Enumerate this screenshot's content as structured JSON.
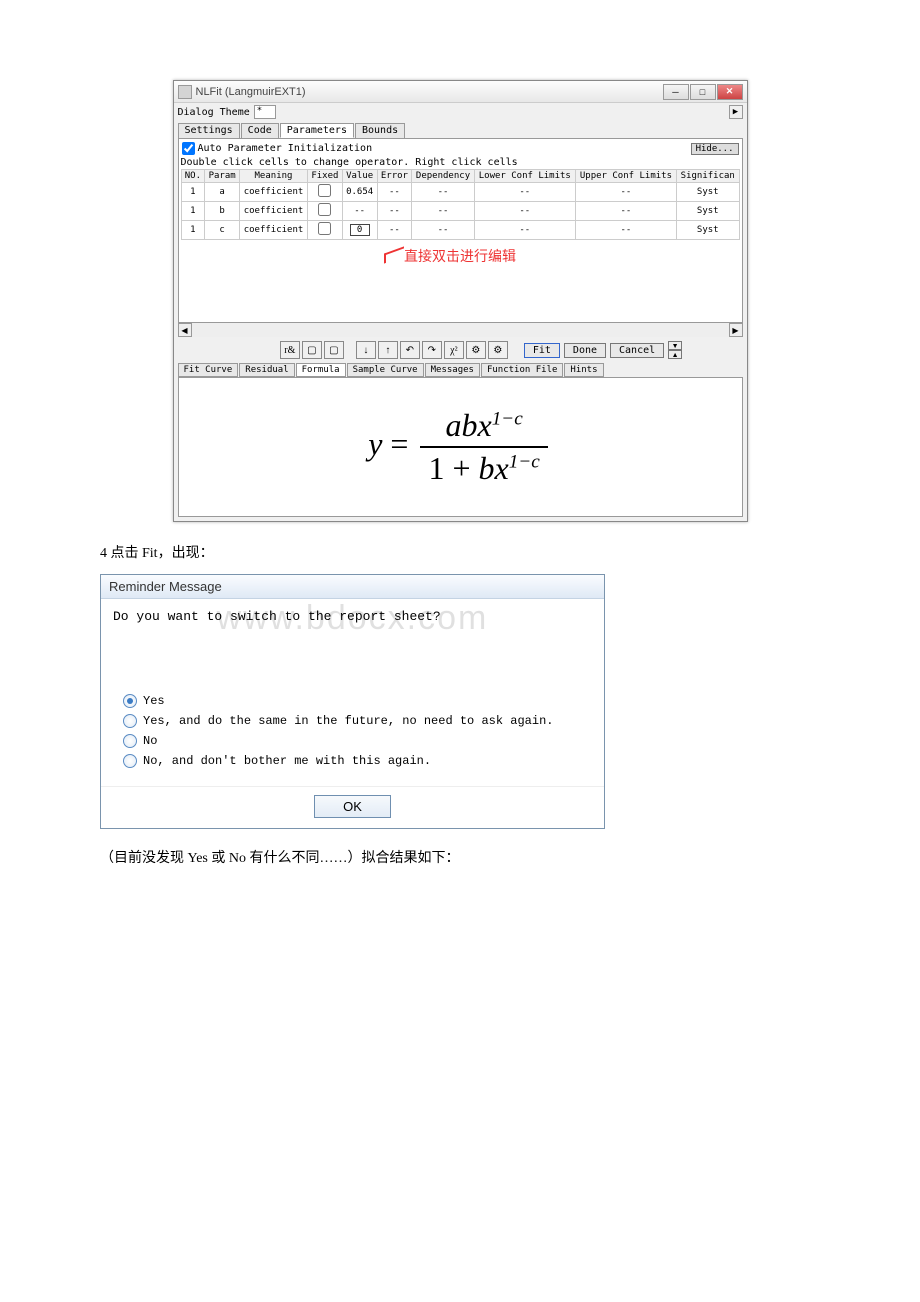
{
  "nlfit": {
    "title": "NLFit (LangmuirEXT1)",
    "dialog_theme_label": "Dialog Theme",
    "theme_value": "*",
    "tabs": {
      "settings": "Settings",
      "code": "Code",
      "parameters": "Parameters",
      "bounds": "Bounds"
    },
    "auto_init_label": "Auto Parameter Initialization",
    "hide_button": "Hide...",
    "hint": "Double click cells to change operator. Right click cells",
    "table": {
      "headers": {
        "no": "NO.",
        "param": "Param",
        "meaning": "Meaning",
        "fixed": "Fixed",
        "value": "Value",
        "error": "Error",
        "dependency": "Dependency",
        "lcl": "Lower Conf Limits",
        "ucl": "Upper Conf Limits",
        "sig": "Significan"
      },
      "rows": [
        {
          "no": "1",
          "param": "a",
          "meaning": "coefficient",
          "value": "0.654",
          "error": "--",
          "dep": "--",
          "lcl": "--",
          "ucl": "--",
          "sig": "Syst"
        },
        {
          "no": "1",
          "param": "b",
          "meaning": "coefficient",
          "value": "--",
          "error": "--",
          "dep": "--",
          "lcl": "--",
          "ucl": "--",
          "sig": "Syst"
        },
        {
          "no": "1",
          "param": "c",
          "meaning": "coefficient",
          "value": "0",
          "error": "--",
          "dep": "--",
          "lcl": "--",
          "ucl": "--",
          "sig": "Syst"
        }
      ]
    },
    "annotation": "直接双击进行编辑",
    "actions": {
      "fit": "Fit",
      "done": "Done",
      "cancel": "Cancel"
    },
    "lower_tabs": {
      "fit_curve": "Fit Curve",
      "residual": "Residual",
      "formula": "Formula",
      "sample_curve": "Sample Curve",
      "messages": "Messages",
      "function_file": "Function File",
      "hints": "Hints"
    }
  },
  "caption1": "4 点击 Fit，出现：",
  "reminder": {
    "title": "Reminder Message",
    "question": "Do you want to switch to the report sheet?",
    "watermark": "www.bdocx.com",
    "options": {
      "yes": "Yes",
      "yes_future": "Yes, and do the same in the future, no need to ask again.",
      "no": "No",
      "no_future": "No, and don't bother me with this again."
    },
    "ok": "OK"
  },
  "caption2": "（目前没发现 Yes 或 No 有什么不同……）拟合结果如下："
}
